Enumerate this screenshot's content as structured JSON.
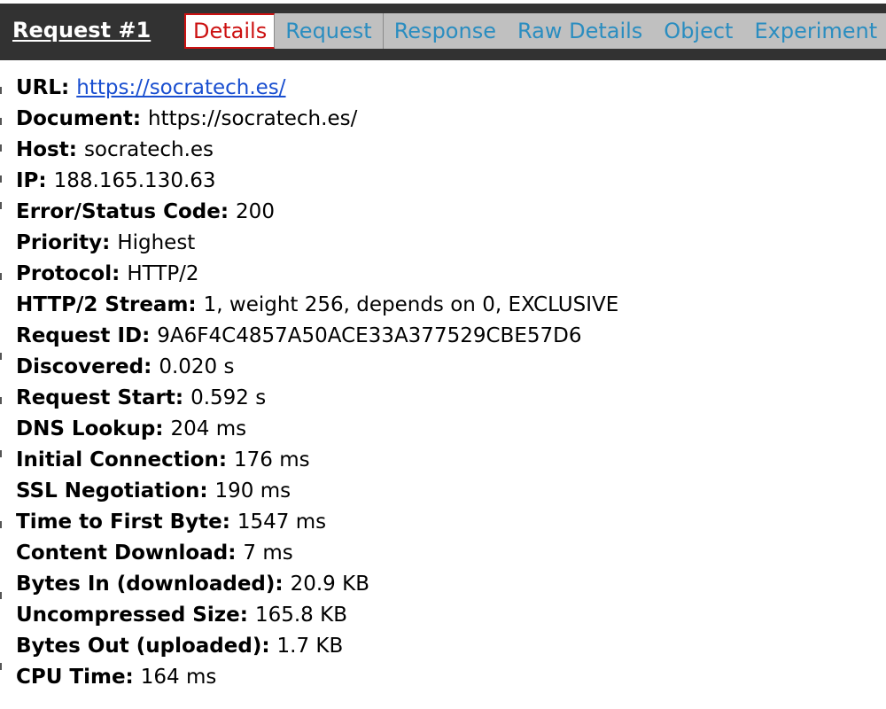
{
  "header": {
    "title": "Request #1",
    "tabs": [
      {
        "label": "Details",
        "active": true
      },
      {
        "label": "Request",
        "active": false
      },
      {
        "label": "Response",
        "active": false
      },
      {
        "label": "Raw Details",
        "active": false
      },
      {
        "label": "Object",
        "active": false
      },
      {
        "label": "Experiment",
        "active": false
      }
    ]
  },
  "details": [
    {
      "label": "URL:",
      "value": "https://socratech.es/",
      "link": true
    },
    {
      "label": "Document:",
      "value": "https://socratech.es/"
    },
    {
      "label": "Host:",
      "value": "socratech.es"
    },
    {
      "label": "IP:",
      "value": "188.165.130.63"
    },
    {
      "label": "Error/Status Code:",
      "value": "200"
    },
    {
      "label": "Priority:",
      "value": "Highest"
    },
    {
      "label": "Protocol:",
      "value": "HTTP/2"
    },
    {
      "label": "HTTP/2 Stream:",
      "value": "1, weight 256, depends on 0, EXCLUSIVE"
    },
    {
      "label": "Request ID:",
      "value": "9A6F4C4857A50ACE33A377529CBE57D6"
    },
    {
      "label": "Discovered:",
      "value": "0.020 s"
    },
    {
      "label": "Request Start:",
      "value": "0.592 s"
    },
    {
      "label": "DNS Lookup:",
      "value": "204 ms"
    },
    {
      "label": "Initial Connection:",
      "value": "176 ms"
    },
    {
      "label": "SSL Negotiation:",
      "value": "190 ms"
    },
    {
      "label": "Time to First Byte:",
      "value": "1547 ms"
    },
    {
      "label": "Content Download:",
      "value": "7 ms"
    },
    {
      "label": "Bytes In (downloaded):",
      "value": "20.9 KB"
    },
    {
      "label": "Uncompressed Size:",
      "value": "165.8 KB"
    },
    {
      "label": "Bytes Out (uploaded):",
      "value": "1.7 KB"
    },
    {
      "label": "CPU Time:",
      "value": "164 ms"
    }
  ],
  "colors": {
    "header_bg": "#323232",
    "tab_bar_bg": "#c0c0c0",
    "tab_text": "#2a8dc0",
    "active_tab_text": "#cc1111",
    "link": "#1a4fd0"
  }
}
